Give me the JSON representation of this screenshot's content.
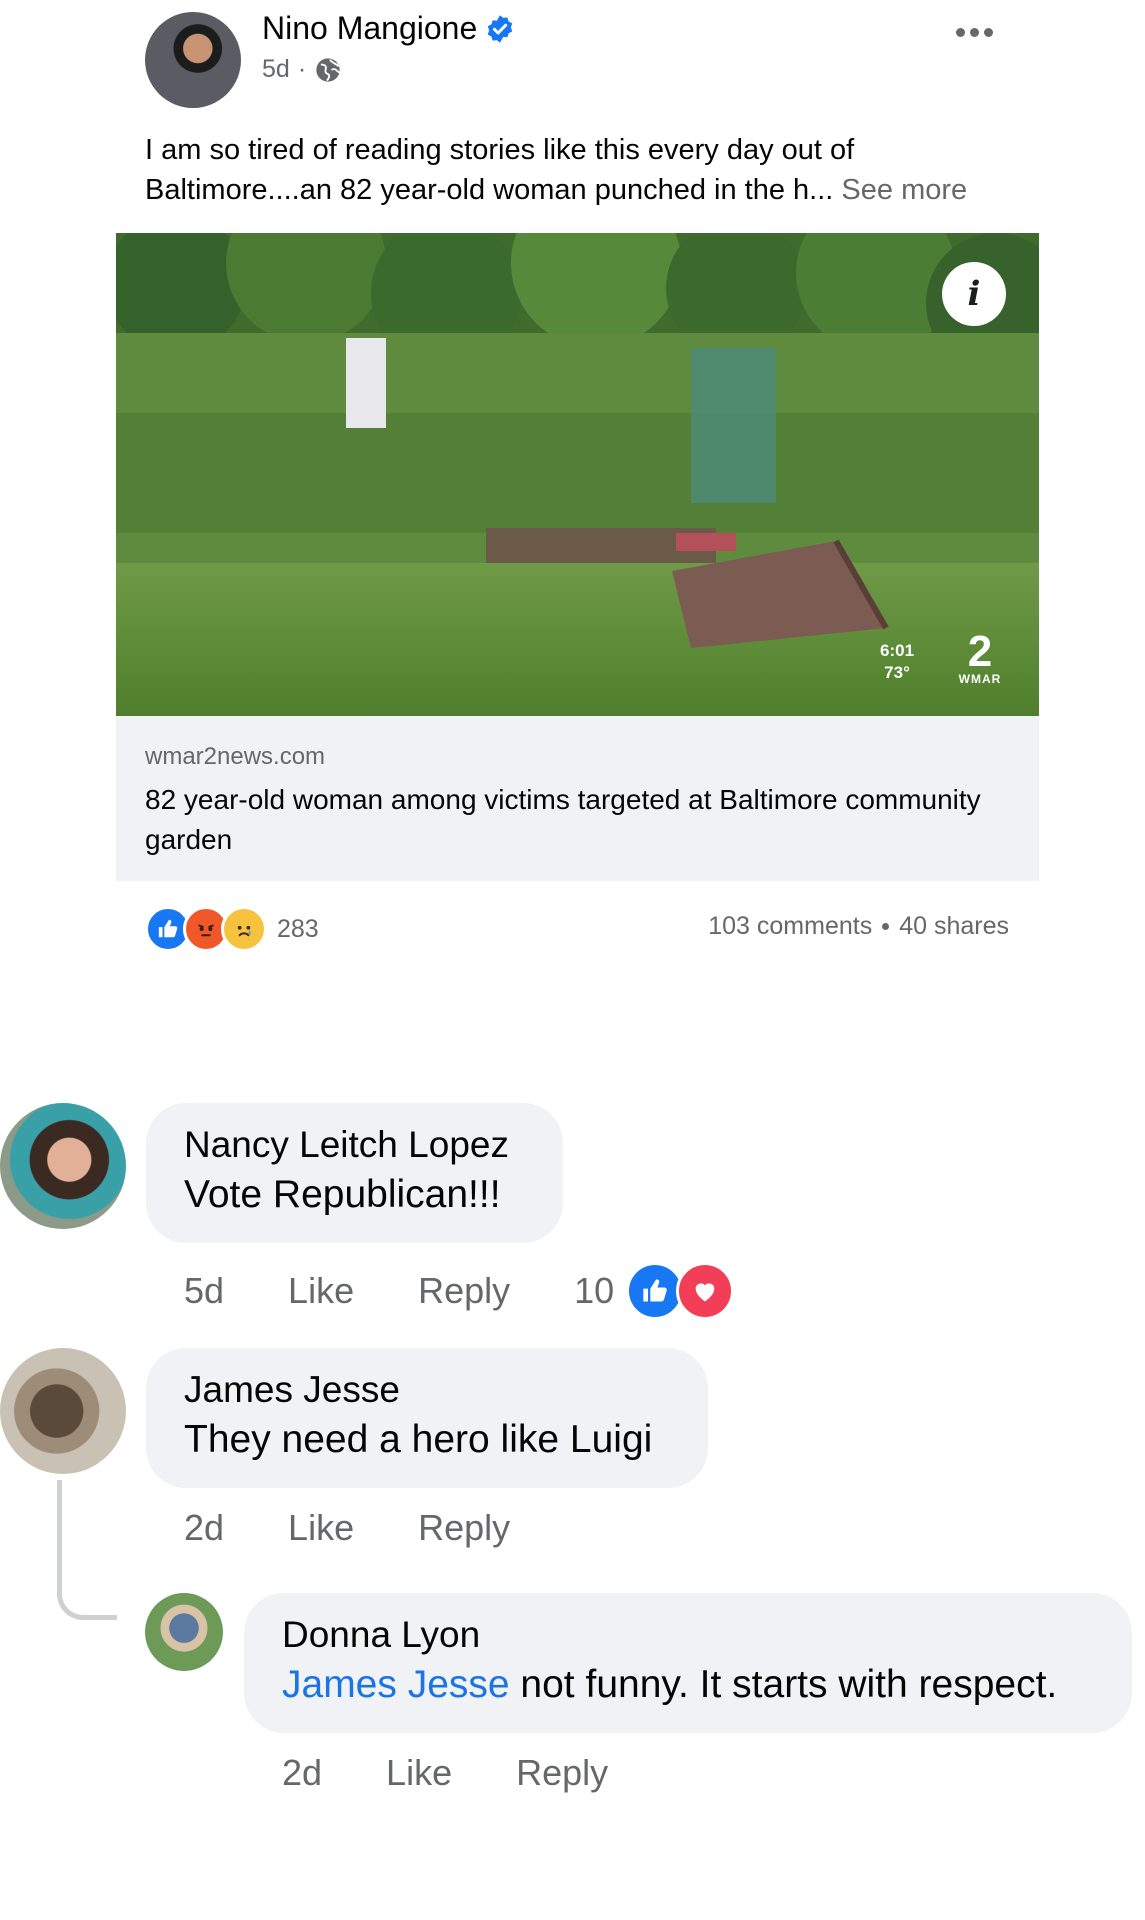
{
  "post": {
    "author": "Nino Mangione",
    "time": "5d",
    "meta_separator": "·",
    "text_truncated": "I am so tired of reading stories like this every day out of Baltimore....an 82 year-old woman punched in the h...",
    "see_more": "See more",
    "link_preview": {
      "domain": "wmar2news.com",
      "title": "82 year-old woman among victims targeted at Baltimore community garden",
      "info_label": "i",
      "time_overlay": "6:01",
      "temp_overlay": "73°",
      "station_number": "2",
      "station_name": "WMAR"
    },
    "reactions": {
      "icons": [
        "like-icon",
        "angry-icon",
        "sad-icon"
      ],
      "count": "283"
    },
    "comments_count": "103 comments",
    "shares_count": "40 shares"
  },
  "comments": [
    {
      "author": "Nancy Leitch Lopez",
      "text": "Vote Republican!!!",
      "time": "5d",
      "like_label": "Like",
      "reply_label": "Reply",
      "reaction_count": "10",
      "reaction_icons": [
        "like-icon",
        "love-icon"
      ]
    },
    {
      "author": "James Jesse",
      "text": "They need a hero like Luigi",
      "time": "2d",
      "like_label": "Like",
      "reply_label": "Reply",
      "replies": [
        {
          "author": "Donna Lyon",
          "mention": "James Jesse",
          "text": " not funny. It starts with respect.",
          "time": "2d",
          "like_label": "Like",
          "reply_label": "Reply"
        }
      ]
    }
  ],
  "colors": {
    "brand_blue": "#1b74e4",
    "like_blue": "#1877f2",
    "love_red": "#f33e58",
    "angry_orange": "#f0582a",
    "sad_yellow": "#f7c33e",
    "bubble_gray": "#f0f2f5",
    "secondary_text": "#65676b"
  }
}
